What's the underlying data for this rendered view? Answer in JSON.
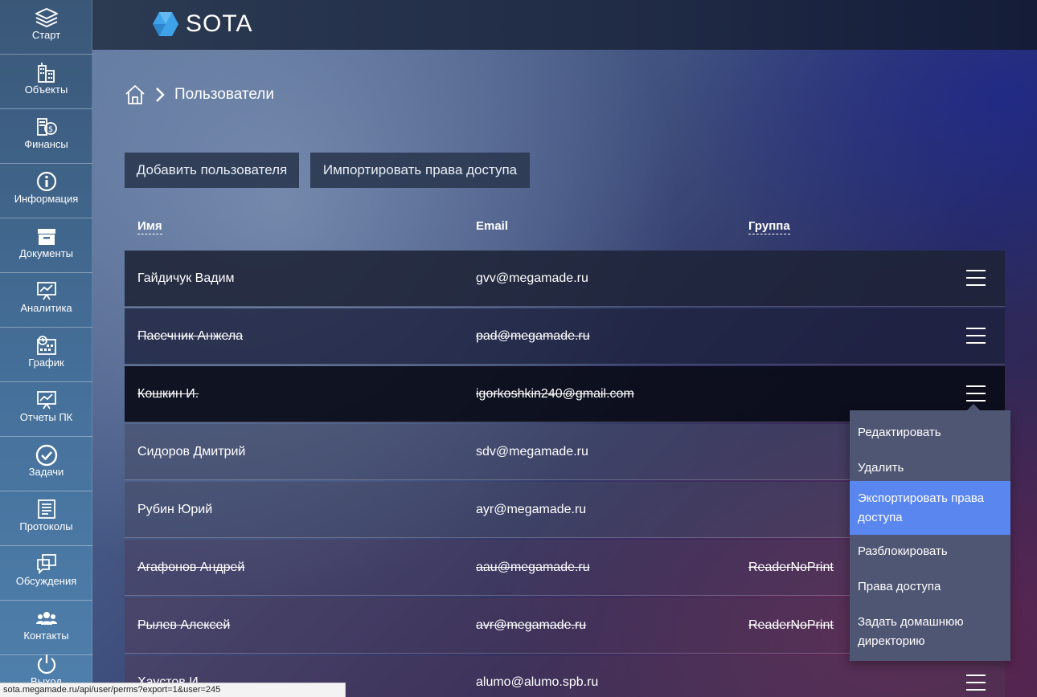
{
  "app": {
    "logo_text": "SOTA",
    "brand_color": "#3ea3e8"
  },
  "sidebar": {
    "items": [
      {
        "label": "Старт",
        "icon": "layers-icon"
      },
      {
        "label": "Объекты",
        "icon": "buildings-icon"
      },
      {
        "label": "Финансы",
        "icon": "finance-icon"
      },
      {
        "label": "Информация",
        "icon": "info-icon"
      },
      {
        "label": "Документы",
        "icon": "archive-box-icon"
      },
      {
        "label": "Аналитика",
        "icon": "presentation-chart-icon"
      },
      {
        "label": "График",
        "icon": "calendar-schedule-icon"
      },
      {
        "label": "Отчеты ПК",
        "icon": "report-board-icon"
      },
      {
        "label": "Задачи",
        "icon": "check-circle-icon"
      },
      {
        "label": "Протоколы",
        "icon": "document-list-icon"
      },
      {
        "label": "Обсуждения",
        "icon": "chat-windows-icon"
      },
      {
        "label": "Контакты",
        "icon": "contacts-group-icon"
      },
      {
        "label": "Выход",
        "icon": "power-icon"
      }
    ]
  },
  "breadcrumb": {
    "current": "Пользователи"
  },
  "toolbar": {
    "add_user": "Добавить пользователя",
    "import_perms": "Импортировать права доступа"
  },
  "table": {
    "headers": {
      "name": "Имя",
      "email": "Email",
      "group": "Группа"
    },
    "rows": [
      {
        "name": "Гайдичук Вадим",
        "email": "gvv@megamade.ru",
        "group": "",
        "blocked": false
      },
      {
        "name": "Пасечник Анжела",
        "email": "pad@megamade.ru",
        "group": "",
        "blocked": true
      },
      {
        "name": "Кошкин И.",
        "email": "igorkoshkin240@gmail.com",
        "group": "",
        "blocked": true
      },
      {
        "name": "Сидоров Дмитрий",
        "email": "sdv@megamade.ru",
        "group": "",
        "blocked": false
      },
      {
        "name": "Рубин Юрий",
        "email": "ayr@megamade.ru",
        "group": "",
        "blocked": false
      },
      {
        "name": "Агафонов Андрей",
        "email": "aau@megamade.ru",
        "group": "ReaderNoPrint",
        "blocked": true
      },
      {
        "name": "Рылев Алексей",
        "email": "avr@megamade.ru",
        "group": "ReaderNoPrint",
        "blocked": true
      },
      {
        "name": "Хаустов И.",
        "email": "alumo@alumo.spb.ru",
        "group": "",
        "blocked": false
      }
    ]
  },
  "row_menu": {
    "items": [
      "Редактировать",
      "Удалить",
      "Экспортировать права доступа",
      "Разблокировать",
      "Права доступа",
      "Задать домашнюю директорию"
    ],
    "active_item": "Экспортировать права доступа",
    "active_color": "#5a86f0"
  },
  "status_bar": {
    "url": "sota.megamade.ru/api/user/perms?export=1&user=245"
  }
}
